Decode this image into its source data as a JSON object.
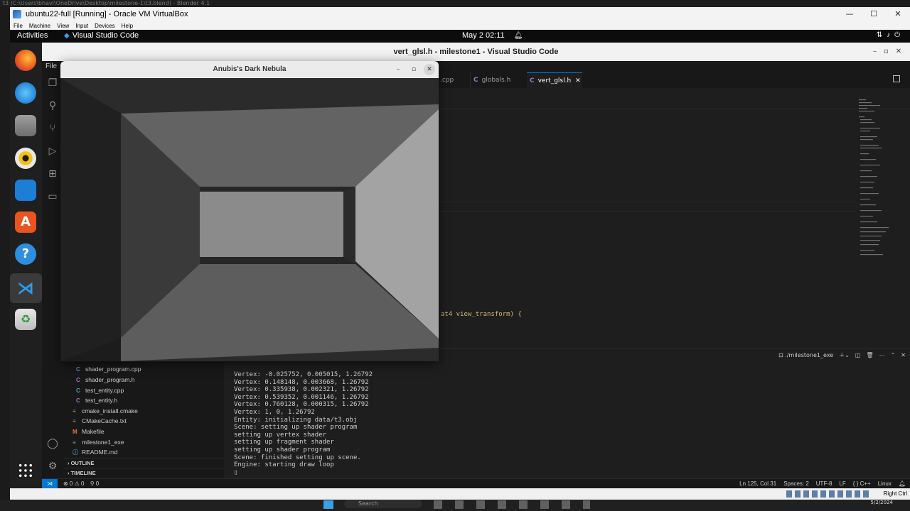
{
  "blender": {
    "title": "t3 (C:\\Users\\bhavi\\OneDrive\\Desktop\\milestone-1\\t3.blend) - Blender 4.1"
  },
  "vbox": {
    "title": "ubuntu22-full [Running] - Oracle VM VirtualBox",
    "menu": [
      "File",
      "Machine",
      "View",
      "Input",
      "Devices",
      "Help"
    ],
    "right_ctrl": "Right Ctrl"
  },
  "gnome": {
    "activities": "Activities",
    "app_name": "Visual Studio Code",
    "clock": "May 2  02:11"
  },
  "vscode": {
    "window_title": "vert_glsl.h - milestone1 - Visual Studio Code",
    "menu_first": "File",
    "tabs": [
      {
        "label": ".cpp"
      },
      {
        "label": "globals.h"
      },
      {
        "label": "vert_glsl.h"
      }
    ],
    "code_fragment": "at4 view_transform) {",
    "explorer_files": [
      {
        "icon": "C",
        "label": "shader_program.cpp"
      },
      {
        "icon": "C",
        "label": "shader_program.h"
      },
      {
        "icon": "C",
        "label": "test_entity.cpp"
      },
      {
        "icon": "C",
        "label": "test_entity.h"
      },
      {
        "icon": "≡",
        "label": "cmake_install.cmake"
      },
      {
        "icon": "≡",
        "label": "CMakeCache.txt"
      },
      {
        "icon": "M",
        "label": "Makefile"
      },
      {
        "icon": "≡",
        "label": "milestone1_exe"
      },
      {
        "icon": "ⓘ",
        "label": "README.md"
      }
    ],
    "outline_label": "OUTLINE",
    "timeline_label": "TIMELINE",
    "terminal_name": "./milestone1_exe",
    "terminal_lines": [
      "Vertex: -0.025752, 0.005015, 1.26792",
      "Vertex: 0.148148, 0.003668, 1.26792",
      "Vertex: 0.335938, 0.002321, 1.26792",
      "Vertex: 0.539352, 0.001146, 1.26792",
      "Vertex: 0.760128, 0.000315, 1.26792",
      "Vertex: 1, 0, 1.26792",
      "Entity: initializing data/t3.obj",
      "Scene: setting up shader program",
      "setting up vertex shader",
      "setting up fragment shader",
      "setting up shader program",
      "Scene: finished setting up scene.",
      "Engine: starting draw loop",
      "▯"
    ],
    "status": {
      "errors": "⊗ 0 ⚠ 0",
      "ports": "⚲ 0",
      "position": "Ln 125, Col 31",
      "spaces": "Spaces: 2",
      "encoding": "UTF-8",
      "eol": "LF",
      "language": "{ } C++",
      "platform": "Linux"
    }
  },
  "game": {
    "title": "Anubis's Dark Nebula"
  },
  "taskbar": {
    "search": "Search",
    "date": "5/2/2024"
  },
  "colors": {
    "accent": "#0078d4",
    "vscode_bg": "#1e1e1e",
    "sidebar_bg": "#181818"
  }
}
